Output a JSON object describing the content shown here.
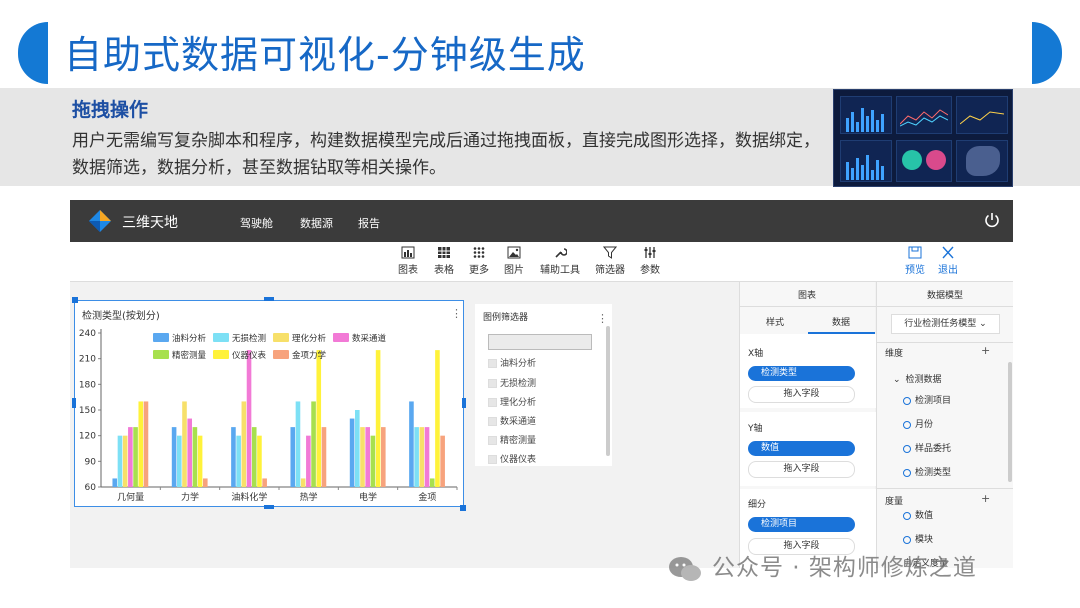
{
  "slide": {
    "title": "自助式数据可视化-分钟级生成",
    "heading": "拖拽操作",
    "description": "用户无需编写复杂脚本和程序，构建数据模型完成后通过拖拽面板，直接完成图形选择，数据绑定，数据筛选，数据分析，甚至数据钻取等相关操作。",
    "watermark": "公众号 · 架构师修炼之道",
    "accent_color": "#1479d4"
  },
  "app": {
    "name": "三维天地",
    "nav": [
      "驾驶舱",
      "数据源",
      "报告"
    ],
    "toolbar": [
      "图表",
      "表格",
      "更多",
      "图片",
      "辅助工具",
      "筛选器",
      "参数"
    ],
    "actions": {
      "preview": "预览",
      "exit": "退出"
    },
    "icons": [
      "logo-icon",
      "power-icon",
      "chart-icon",
      "table-icon",
      "more-icon",
      "image-icon",
      "tools-icon",
      "filter-icon",
      "param-icon",
      "preview-icon",
      "exit-icon"
    ]
  },
  "chart_widget": {
    "title": "检测类型(按划分)",
    "menu": "⋮"
  },
  "chart_data": {
    "type": "bar",
    "title": "检测类型(按划分)",
    "categories": [
      "几何量",
      "力学",
      "油料化学",
      "热学",
      "电学",
      "金项"
    ],
    "ylim": [
      60,
      240
    ],
    "yticks": [
      60,
      90,
      120,
      150,
      180,
      210,
      240
    ],
    "legend_position": "top",
    "series": [
      {
        "name": "油料分析",
        "color": "#5aa8f0",
        "values": [
          70,
          130,
          130,
          130,
          140,
          160
        ]
      },
      {
        "name": "无损检测",
        "color": "#7de0f5",
        "values": [
          120,
          120,
          120,
          160,
          150,
          130
        ]
      },
      {
        "name": "理化分析",
        "color": "#f7e06a",
        "values": [
          120,
          160,
          160,
          70,
          130,
          130
        ]
      },
      {
        "name": "数采通道",
        "color": "#f27ad6",
        "values": [
          130,
          140,
          220,
          120,
          130,
          130
        ]
      },
      {
        "name": "精密测量",
        "color": "#a7e04e",
        "values": [
          130,
          130,
          130,
          160,
          120,
          70
        ]
      },
      {
        "name": "仪器仪表",
        "color": "#fff23a",
        "values": [
          160,
          120,
          120,
          220,
          220,
          220
        ]
      },
      {
        "name": "金项力学",
        "color": "#f7a37d",
        "values": [
          160,
          70,
          70,
          130,
          130,
          120
        ]
      }
    ]
  },
  "filter_widget": {
    "title": "图例筛选器",
    "menu": "⋮",
    "items": [
      "油料分析",
      "无损检测",
      "理化分析",
      "数采通道",
      "精密测量",
      "仪器仪表"
    ]
  },
  "panel_mid": {
    "header": "图表",
    "tabs": [
      "样式",
      "数据"
    ],
    "x_label": "X轴",
    "x_field": "检测类型",
    "y_label": "Y轴",
    "y_field": "数值",
    "split_label": "细分",
    "split_field": "检测项目",
    "drop_text": "拖入字段"
  },
  "panel_right": {
    "header": "数据模型",
    "model_select": "行业检测任务模型 ⌄",
    "dimension_label": "维度",
    "folder": "检测数据",
    "dimensions": [
      "检测项目",
      "月份",
      "样品委托",
      "检测类型"
    ],
    "measure_label": "度量",
    "measures": [
      "数值",
      "模块"
    ],
    "extra": "自定义度量"
  }
}
